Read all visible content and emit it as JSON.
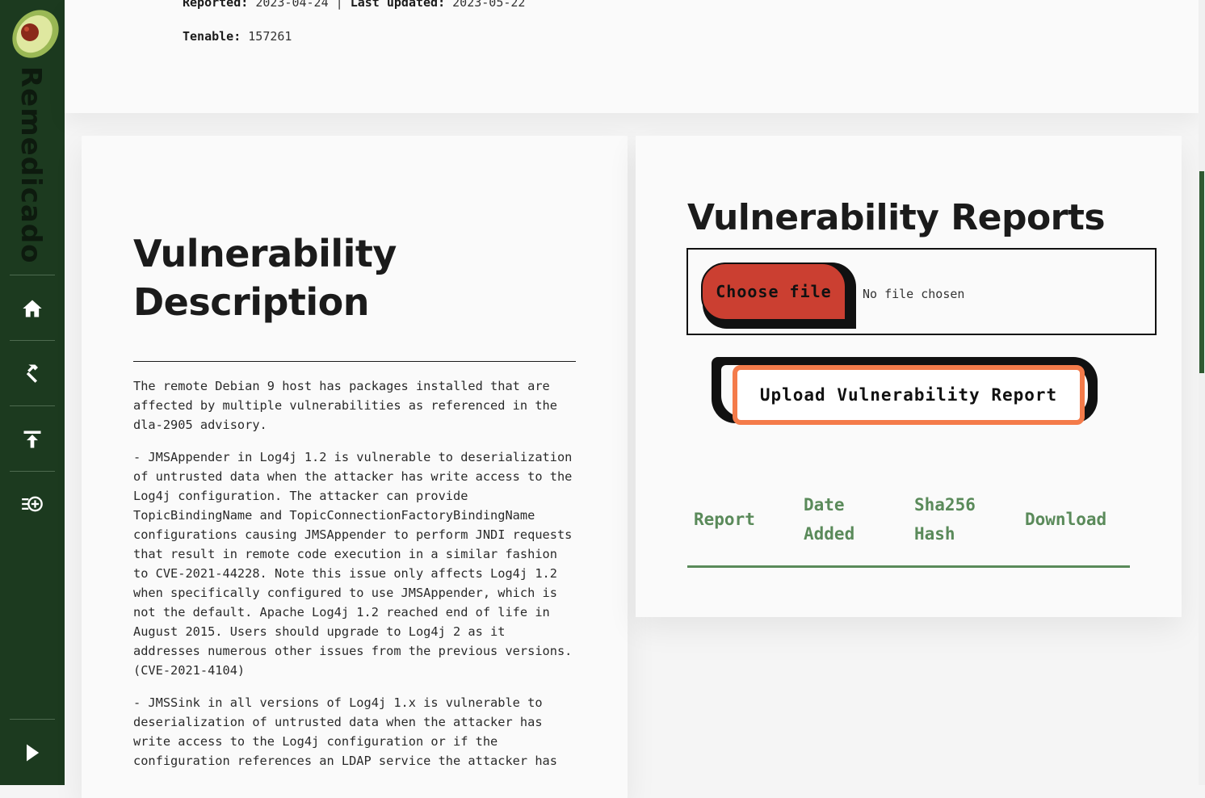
{
  "sidebar": {
    "brand": "Remedicado",
    "nav": [
      {
        "name": "home-icon"
      },
      {
        "name": "hammer-icon"
      },
      {
        "name": "upload-icon"
      },
      {
        "name": "add-list-icon"
      }
    ],
    "expand_icon": "play-arrow-icon"
  },
  "meta": {
    "reported_label": "Reported:",
    "reported_value": "2023-04-24",
    "separator": "|",
    "updated_label": "Last updated:",
    "updated_value": "2023-05-22",
    "tenable_label": "Tenable:",
    "tenable_value": "157261"
  },
  "description": {
    "title": "Vulnerability Description",
    "paragraphs": [
      "The remote Debian 9 host has packages installed that are affected by multiple vulnerabilities as referenced in the dla-2905 advisory.",
      "- JMSAppender in Log4j 1.2 is vulnerable to deserialization of untrusted data when the attacker has write access to the Log4j configuration. The attacker can provide TopicBindingName and TopicConnectionFactoryBindingName configurations causing JMSAppender to perform JNDI requests that result in remote code execution in a similar fashion to CVE-2021-44228. Note this issue only affects Log4j 1.2 when specifically configured to use JMSAppender, which is not the default. Apache Log4j 1.2 reached end of life in August 2015. Users should upgrade to Log4j 2 as it addresses numerous other issues from the previous versions. (CVE-2021-4104)",
      "- JMSSink in all versions of Log4j 1.x is vulnerable to deserialization of untrusted data when the attacker has write access to the Log4j configuration or if the configuration references an LDAP service the attacker has"
    ]
  },
  "reports": {
    "title": "Vulnerability Reports",
    "choose_file_label": "Choose file",
    "no_file_text": "No file chosen",
    "upload_label": "Upload Vulnerability Report",
    "columns": [
      "Report",
      "Date\nAdded",
      "Sha256\nHash",
      "Download"
    ]
  },
  "colors": {
    "sidebar": "#1c3a1f",
    "choose_button": "#cb3f31",
    "upload_focus": "#f47b4a",
    "table_header": "#5a8a5a"
  }
}
